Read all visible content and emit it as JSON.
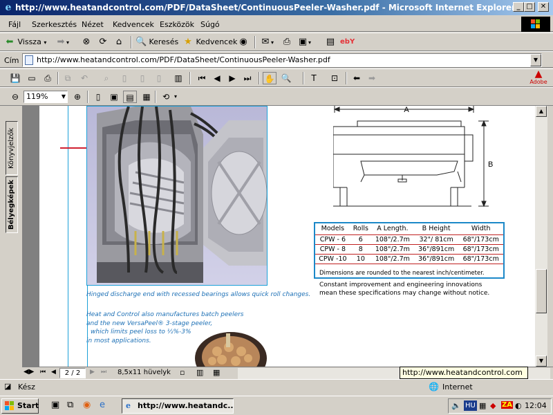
{
  "window": {
    "title": "http://www.heatandcontrol.com/PDF/DataSheet/ContinuousPeeler-Washer.pdf - Microsoft Internet Explorer",
    "minimize": "_",
    "maximize": "□",
    "close": "✕"
  },
  "menu": {
    "items": [
      "Fájl",
      "Szerkesztés",
      "Nézet",
      "Kedvencek",
      "Eszközök",
      "Súgó"
    ]
  },
  "toolbar": {
    "back_label": "Vissza",
    "search_label": "Keresés",
    "favorites_label": "Kedvencek",
    "ebay_label": "ebY"
  },
  "address": {
    "label": "Cím",
    "url": "http://www.heatandcontrol.com/PDF/DataSheet/ContinuousPeeler-Washer.pdf"
  },
  "acrobat": {
    "zoom": "119%",
    "adobe_label": "Adobe",
    "side_tabs": [
      "Könyvjelzők",
      "Bélyegképek"
    ],
    "page_indicator": "2 / 2",
    "page_size": "8,5x11 hüvelyk"
  },
  "document": {
    "photo_caption": "Hinged discharge end with recessed bearings allows quick roll changes.",
    "info_lines": [
      "Heat and Control also manufactures batch peelers",
      "and the new VersaPeel® 3-stage peeler,",
      "which limits peel loss to ½%-3%",
      "in most applications."
    ],
    "drawing_label_a": "A",
    "drawing_label_b": "B",
    "table": {
      "headers": [
        "Models",
        "Rolls",
        "A Length.",
        "B Height",
        "Width"
      ],
      "rows": [
        [
          "CPW - 6",
          "6",
          "108\"/2.7m",
          "32\"/ 81cm",
          "68\"/173cm"
        ],
        [
          "CPW - 8",
          "8",
          "108\"/2.7m",
          "36\"/891cm",
          "68\"/173cm"
        ],
        [
          "CPW -10",
          "10",
          "108\"/2.7m",
          "36\"/891cm",
          "68\"/173cm"
        ]
      ],
      "note": "Dimensions are rounded to the nearest inch/centimeter."
    },
    "disclaimer": [
      "Constant improvement and engineering innovations",
      "mean these specifications may change without notice."
    ]
  },
  "statusbar": {
    "status": "Kész",
    "zone": "Internet",
    "tooltip": "http://www.heatandcontrol.com"
  },
  "taskbar": {
    "start_label": "Start",
    "task_item": "http://www.heatandc...",
    "language": "HU",
    "clock": "12:04"
  }
}
